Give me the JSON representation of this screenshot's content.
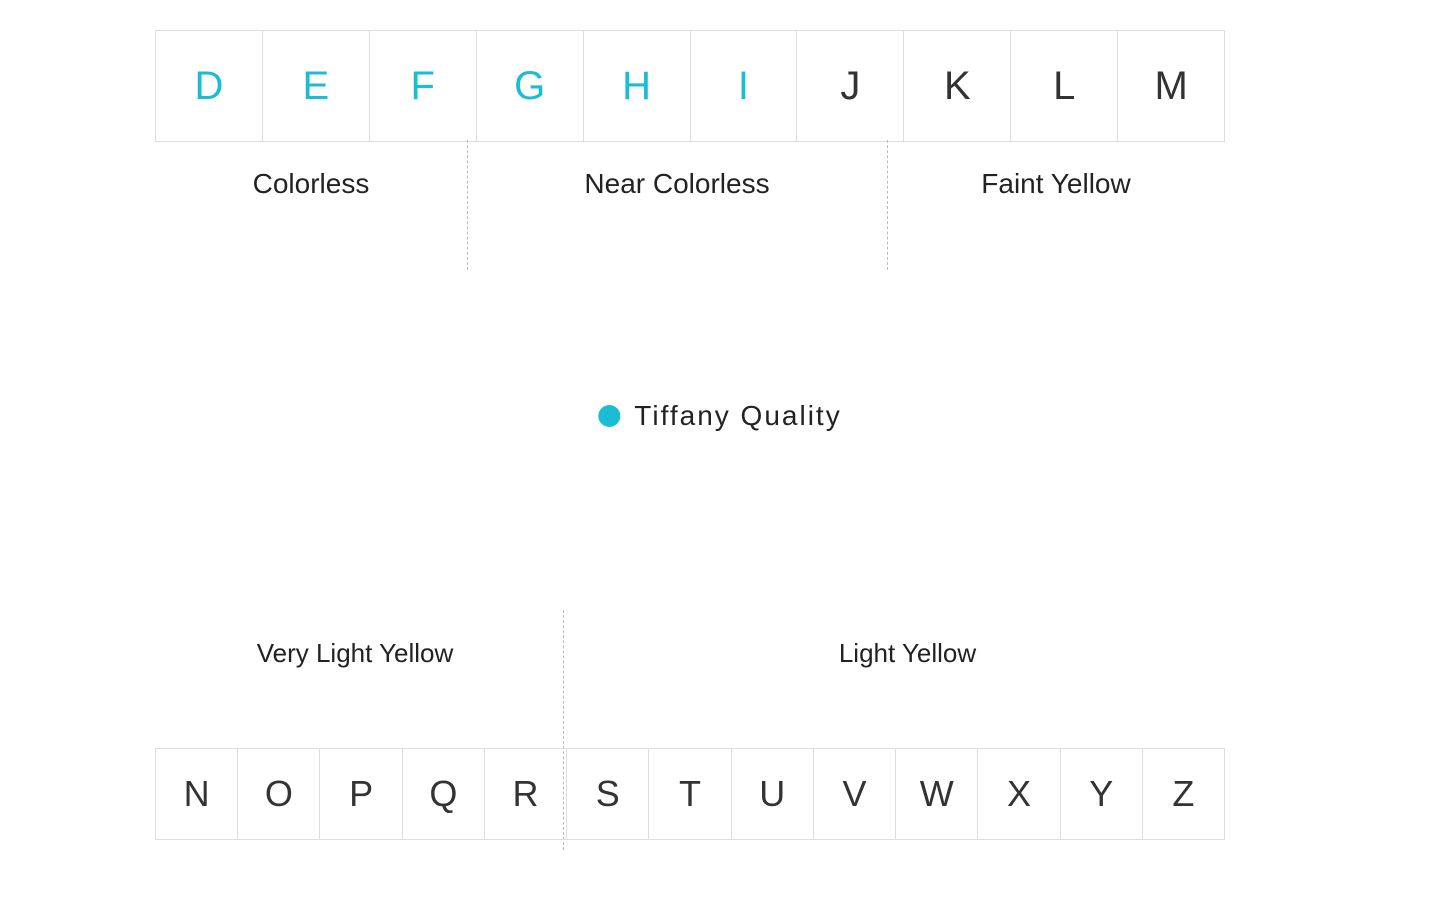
{
  "colors": {
    "tiffany": "#1bbdd4",
    "text": "#222222",
    "grade": "#333333",
    "divider": "#bbbbbb",
    "border": "#dddddd",
    "dot": "#1bbdd4"
  },
  "top_grades": [
    {
      "letter": "D",
      "tiffany": true
    },
    {
      "letter": "E",
      "tiffany": true
    },
    {
      "letter": "F",
      "tiffany": true
    },
    {
      "letter": "G",
      "tiffany": true
    },
    {
      "letter": "H",
      "tiffany": true
    },
    {
      "letter": "I",
      "tiffany": true
    },
    {
      "letter": "J",
      "tiffany": false
    },
    {
      "letter": "K",
      "tiffany": false
    },
    {
      "letter": "L",
      "tiffany": false
    },
    {
      "letter": "M",
      "tiffany": false
    }
  ],
  "bottom_grades": [
    {
      "letter": "N"
    },
    {
      "letter": "O"
    },
    {
      "letter": "P"
    },
    {
      "letter": "Q"
    },
    {
      "letter": "R"
    },
    {
      "letter": "S"
    },
    {
      "letter": "T"
    },
    {
      "letter": "U"
    },
    {
      "letter": "V"
    },
    {
      "letter": "W"
    },
    {
      "letter": "X"
    },
    {
      "letter": "Y"
    },
    {
      "letter": "Z"
    }
  ],
  "categories": {
    "colorless": "Colorless",
    "near_colorless": "Near Colorless",
    "faint_yellow": "Faint Yellow",
    "very_light_yellow": "Very Light Yellow",
    "light_yellow": "Light Yellow"
  },
  "legend": {
    "dot_label": "Tiffany Quality"
  }
}
